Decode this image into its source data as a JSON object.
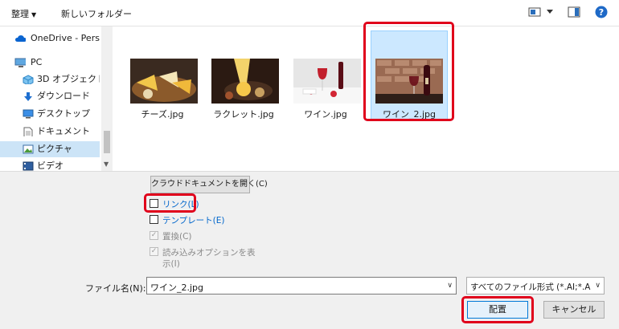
{
  "toolbar": {
    "organize": "整理",
    "new_folder": "新しいフォルダー",
    "help_glyph": "?"
  },
  "nav": {
    "items": [
      {
        "label": "OneDrive - Person",
        "icon": "cloud-icon"
      },
      {
        "label": "PC",
        "icon": "computer-icon"
      },
      {
        "label": "3D オブジェクト",
        "icon": "3d-objects-icon"
      },
      {
        "label": "ダウンロード",
        "icon": "download-icon"
      },
      {
        "label": "デスクトップ",
        "icon": "desktop-icon"
      },
      {
        "label": "ドキュメント",
        "icon": "document-icon"
      },
      {
        "label": "ピクチャ",
        "icon": "pictures-icon",
        "selected": true
      },
      {
        "label": "ビデオ",
        "icon": "video-icon"
      }
    ]
  },
  "files": [
    {
      "name": "チーズ.jpg",
      "icon": "cheese-thumbnail"
    },
    {
      "name": "ラクレット.jpg",
      "icon": "raclette-thumbnail"
    },
    {
      "name": "ワイン.jpg",
      "icon": "wine-thumbnail"
    },
    {
      "name": "ワイン_2.jpg",
      "icon": "wine-2-thumbnail",
      "selected": true
    }
  ],
  "options": {
    "cloud_button": "クラウドドキュメントを開く(C)",
    "link": "リンク(L)",
    "template": "テンプレート(E)",
    "replace": "置換(C)",
    "import_options_line1": "読み込みオプションを表",
    "import_options_line2": "示(I)",
    "check_glyph": "✓"
  },
  "bottom": {
    "filename_label": "ファイル名(N):",
    "filename_value": "ワイン_2.jpg",
    "filetype_value": "すべてのファイル形式 (*.AI;*.AIT;*.PDF",
    "place_button": "配置",
    "cancel_button": "キャンセル"
  },
  "colors": {
    "highlight_red": "#e0001b",
    "selection_blue": "#cce8ff",
    "link_blue": "#0066cc"
  }
}
